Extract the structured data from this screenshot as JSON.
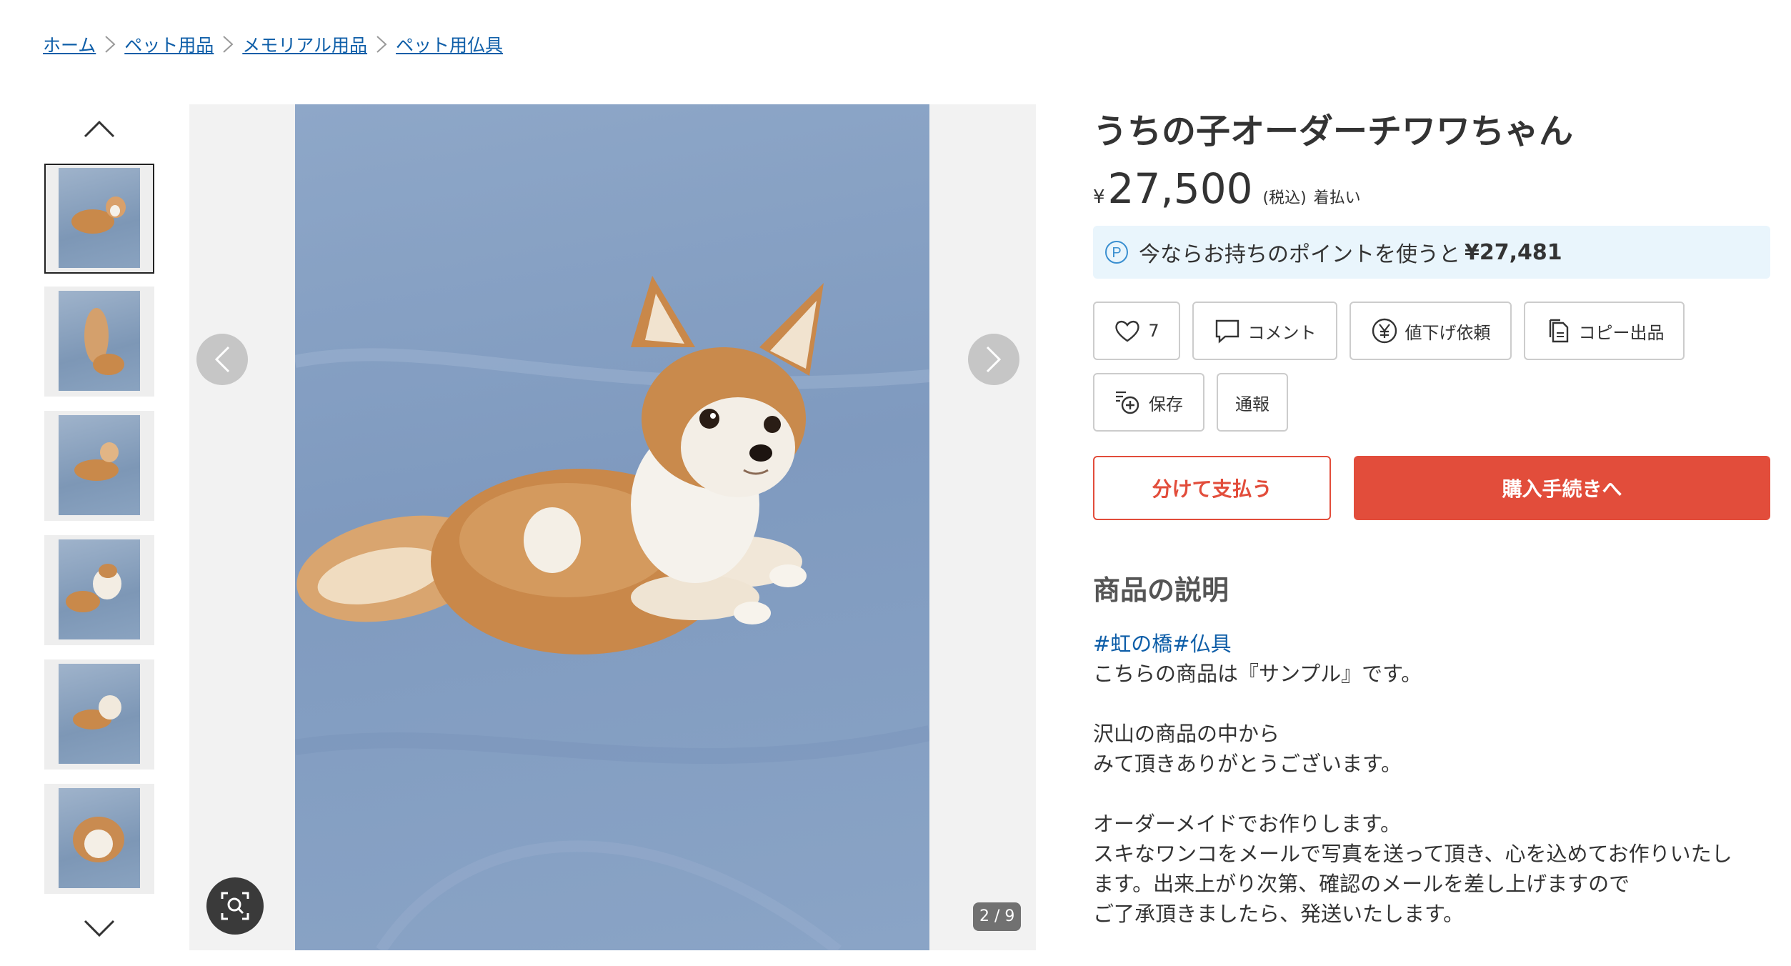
{
  "breadcrumb": [
    "ホーム",
    "ペット用品",
    "メモリアル用品",
    "ペット用仏具"
  ],
  "gallery": {
    "counter": "2 / 9",
    "thumbnail_count": 6,
    "active_index": 0
  },
  "product": {
    "title": "うちの子オーダーチワワちゃん",
    "currency": "¥",
    "price": "27,500",
    "tax_note": "(税込)",
    "shipping": "着払い",
    "points_text": "今ならお持ちのポイントを使うと",
    "points_price": "¥27,481"
  },
  "actions": {
    "like_count": "7",
    "comment": "コメント",
    "price_request": "値下げ依頼",
    "copy_listing": "コピー出品",
    "save": "保存",
    "report": "通報"
  },
  "buttons": {
    "split_pay": "分けて支払う",
    "buy": "購入手続きへ"
  },
  "description": {
    "heading": "商品の説明",
    "hashtags": "#虹の橋#仏具",
    "lines": [
      "こちらの商品は『サンプル』です。",
      "",
      "沢山の商品の中から",
      "みて頂きありがとうございます。",
      "",
      "オーダーメイドでお作りします。",
      "スキなワンコをメールで写真を送って頂き、心を込めてお作りいたし",
      "ます。出来上がり次第、確認のメールを差し上げますので",
      "ご了承頂きましたら、発送いたします。"
    ]
  },
  "colors": {
    "link": "#0e5ea8",
    "accent": "#e24d3b",
    "point_bg": "#e9f5fc"
  }
}
